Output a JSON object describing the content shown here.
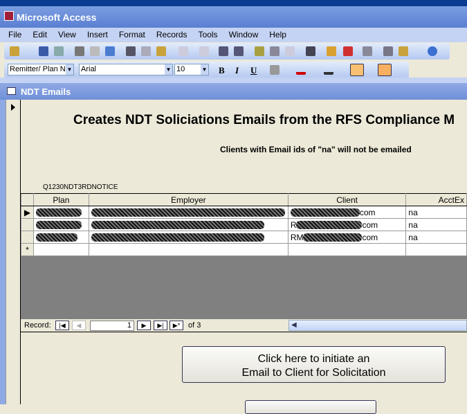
{
  "app": {
    "title": "Microsoft Access"
  },
  "menu": [
    "File",
    "Edit",
    "View",
    "Insert",
    "Format",
    "Records",
    "Tools",
    "Window",
    "Help"
  ],
  "formatting": {
    "object": "Remitter/ Plan N",
    "font": "Arial",
    "size": "10",
    "bold": "B",
    "italic": "I",
    "underline": "U"
  },
  "window": {
    "title": "NDT Emails"
  },
  "form": {
    "heading": "Creates NDT Soliciations Emails from the RFS Compliance M",
    "subheading": "Clients with Email ids of \"na\" will not be emailed",
    "subform_label": "Q1230NDT3RDNOTICE",
    "columns": [
      "Plan",
      "Employer",
      "Client",
      "AcctEx"
    ],
    "rows": [
      {
        "client": "com",
        "acctex": "na"
      },
      {
        "client": "R",
        "client_end": "com",
        "acctex": "na"
      },
      {
        "client": "RM",
        "client_end": "com",
        "acctex": "na"
      }
    ],
    "new_row_marker": "*",
    "nav": {
      "label": "Record:",
      "current": "1",
      "of": "of 3"
    },
    "button1_line1": "Click here to initiate an",
    "button1_line2": "Email to Client for Solicitation"
  }
}
